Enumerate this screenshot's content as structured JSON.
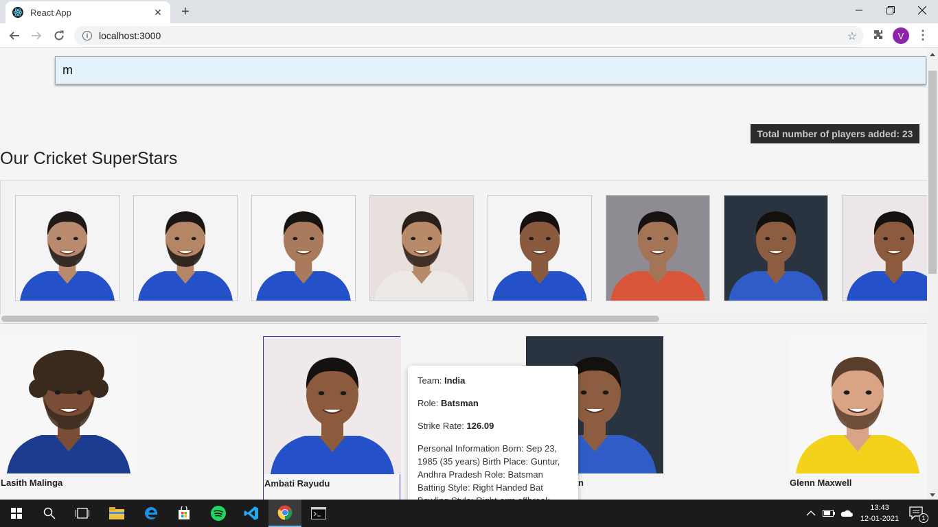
{
  "browser": {
    "tab_title": "React App",
    "url": "localhost:3000",
    "profile_initial": "V"
  },
  "search": {
    "value": "m"
  },
  "summary": {
    "total_label": "Total number of players added: 23"
  },
  "heading": "Our Cricket SuperStars",
  "carousel": {
    "thumbnails": [
      {
        "bg": "#f4f4f6",
        "skin": "#b98a6e",
        "hair": "#1f1a17",
        "shirt": "#2450c8",
        "beard": true
      },
      {
        "bg": "#f4f4f6",
        "skin": "#b58666",
        "hair": "#1a1613",
        "shirt": "#2450c8",
        "beard": true
      },
      {
        "bg": "#f6f6f8",
        "skin": "#a97a5b",
        "hair": "#171412",
        "shirt": "#2450c8",
        "beard": false
      },
      {
        "bg": "#e8e0dd",
        "skin": "#b98a6a",
        "hair": "#2a2019",
        "shirt": "#ece9e6",
        "beard": true
      },
      {
        "bg": "#f4f4f6",
        "skin": "#8a5a3e",
        "hair": "#141110",
        "shirt": "#2450c8",
        "beard": false
      },
      {
        "bg": "#8e8c92",
        "skin": "#a47457",
        "hair": "#16120f",
        "shirt": "#d9553a",
        "beard": false
      },
      {
        "bg": "#2a3440",
        "skin": "#8c5d40",
        "hair": "#14100d",
        "shirt": "#2f5cc7",
        "beard": false
      },
      {
        "bg": "#ece6e8",
        "skin": "#8c5a3c",
        "hair": "#141110",
        "shirt": "#2450c8",
        "beard": false
      }
    ]
  },
  "players": [
    {
      "name": "Lasith Malinga",
      "bg": "#f7f7f7",
      "skin": "#7a4e36",
      "hair": "#3a2a1e",
      "shirt": "#1b3c8f",
      "beard": true,
      "curly": true
    },
    {
      "name": "Ambati Rayudu",
      "bg": "#efe9ec",
      "skin": "#8c5a3c",
      "hair": "#141110",
      "shirt": "#2450c8",
      "beard": false,
      "curly": false
    },
    {
      "name": "Sanju Samson",
      "bg": "#2a3440",
      "skin": "#8c5d40",
      "hair": "#14100d",
      "shirt": "#2f5cc7",
      "beard": false,
      "curly": false
    },
    {
      "name": "Glenn Maxwell",
      "bg": "#f7f7f7",
      "skin": "#d9a486",
      "hair": "#5a3e2b",
      "shirt": "#f2d21b",
      "beard": true,
      "curly": false
    }
  ],
  "card_labels": [
    "Lasith Malinga",
    "Ambati Rayudu",
    "n",
    "Glenn Maxwell"
  ],
  "popover": {
    "team_label": "Team: ",
    "team": "India",
    "role_label": "Role: ",
    "role": "Batsman",
    "strike_label": "Strike Rate: ",
    "strike_rate": "126.09",
    "info": "Personal Information Born: Sep 23, 1985 (35 years) Birth Place: Guntur, Andhra Pradesh Role: Batsman Batting Style: Right Handed Bat Bowling Style: Right-arm offbreak"
  },
  "taskbar": {
    "time": "13:43",
    "date": "12-01-2021",
    "notification_count": "1"
  },
  "colors": {
    "accent_selected": "#2a35c8",
    "badge_bg": "#2b2b2b",
    "search_bg": "#e4f3fb"
  }
}
